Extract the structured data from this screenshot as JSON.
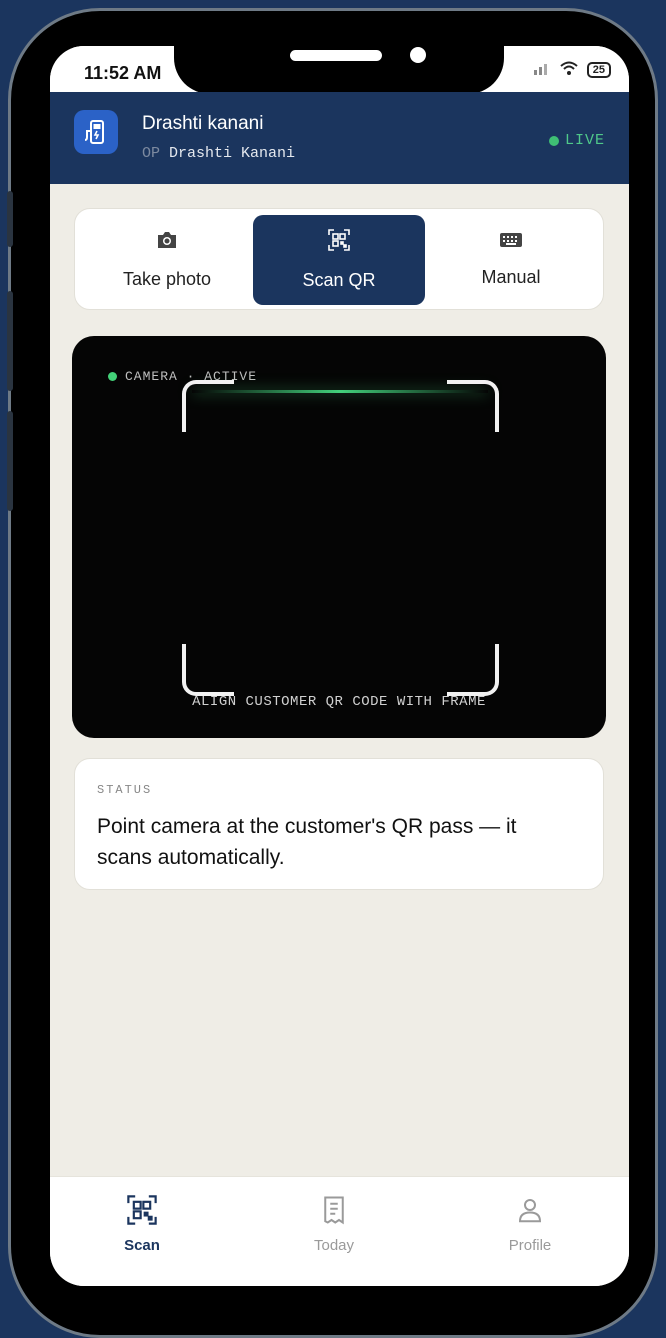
{
  "status_bar": {
    "time": "11:52 AM",
    "battery": "25"
  },
  "header": {
    "operator_name": "Drashti kanani",
    "op_prefix": "OP",
    "op_full_name": "Drashti Kanani",
    "live_label": "LIVE"
  },
  "modes": [
    {
      "label": "Take photo",
      "icon": "camera-icon",
      "active": false
    },
    {
      "label": "Scan QR",
      "icon": "qr-icon",
      "active": true
    },
    {
      "label": "Manual",
      "icon": "keyboard-icon",
      "active": false
    }
  ],
  "camera": {
    "status_text": "CAMERA · ACTIVE",
    "hint": "ALIGN CUSTOMER QR CODE WITH FRAME"
  },
  "status_card": {
    "label": "STATUS",
    "message": "Point camera at the customer's QR pass — it scans automatically."
  },
  "bottom_nav": [
    {
      "label": "Scan",
      "icon": "qr-icon",
      "active": true
    },
    {
      "label": "Today",
      "icon": "receipt-icon",
      "active": false
    },
    {
      "label": "Profile",
      "icon": "user-icon",
      "active": false
    }
  ],
  "colors": {
    "brand": "#1b355e",
    "live": "#4fc88a",
    "background": "#efede6"
  }
}
